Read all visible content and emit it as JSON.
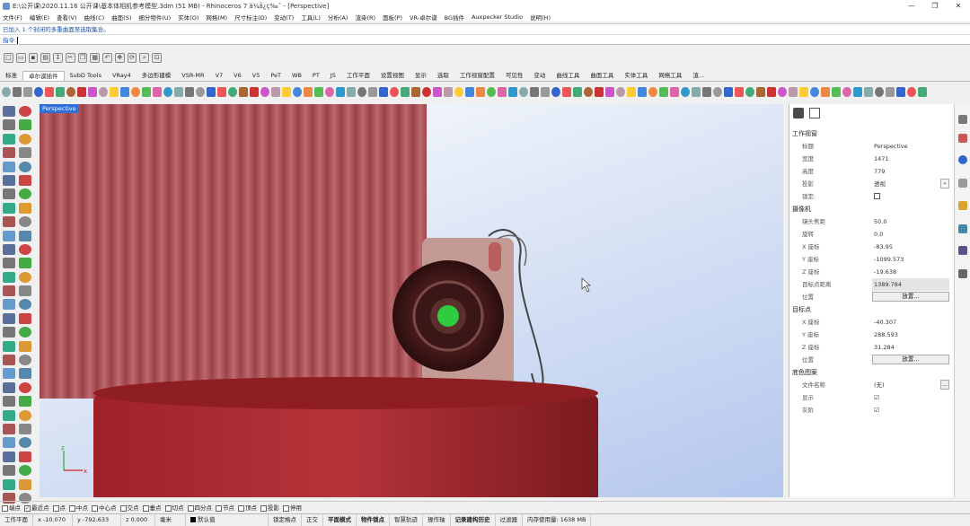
{
  "window": {
    "title": "E:\\公开课\\2020.11.16 公开课\\基本体相机参考模型.3dm (51 MB) - Rhinoceros 7 ä¼å¿ç‰ˆ - [Perspective]",
    "controls": [
      "—",
      "❐",
      "✕"
    ]
  },
  "menu": [
    "文件(F)",
    "编辑(E)",
    "查看(V)",
    "曲线(C)",
    "曲面(S)",
    "细分物件(U)",
    "实体(O)",
    "网格(M)",
    "尺寸标注(D)",
    "变动(T)",
    "工具(L)",
    "分析(A)",
    "渲染(R)",
    "面板(P)",
    "VR-卓尔谟",
    "BG插件",
    "Auxpecker Studio",
    "说明(H)"
  ],
  "command": {
    "history": "已加入 1 个封闭的多重曲面至选取集合。",
    "prompt": "指令:"
  },
  "tabs": [
    "标准",
    "卓尔谟插件",
    "SubD Tools",
    "VRay4",
    "多边形建模",
    "VSR-MR",
    "V7",
    "V6",
    "V5",
    "PeT",
    "WB",
    "PT",
    "JS",
    "工作平面",
    "设置视图",
    "显示",
    "选取",
    "工作视窗配置",
    "可见性",
    "变动",
    "曲线工具",
    "曲面工具",
    "实体工具",
    "网格工具",
    "渲..."
  ],
  "active_tab_index": 1,
  "viewport": {
    "label": "Perspective"
  },
  "properties": {
    "section_viewport": "工作视窗",
    "viewport_rows": [
      {
        "label": "标题",
        "value": "Perspective"
      },
      {
        "label": "宽度",
        "value": "1471"
      },
      {
        "label": "高度",
        "value": "779"
      },
      {
        "label": "投影",
        "value": "透视"
      },
      {
        "label": "锁定",
        "value": ""
      }
    ],
    "section_camera": "摄像机",
    "camera_rows": [
      {
        "label": "镜头焦距",
        "value": "50.0"
      },
      {
        "label": "旋转",
        "value": "0.0"
      },
      {
        "label": "X 座标",
        "value": "-83.95"
      },
      {
        "label": "Y 座标",
        "value": "-1099.573"
      },
      {
        "label": "Z 座标",
        "value": "-19.638"
      },
      {
        "label": "目标点距离",
        "value": "1389.784"
      },
      {
        "label": "位置",
        "value": "放置..."
      }
    ],
    "section_target": "目标点",
    "target_rows": [
      {
        "label": "X 座标",
        "value": "-40.307"
      },
      {
        "label": "Y 座标",
        "value": "288.593"
      },
      {
        "label": "Z 座标",
        "value": "31.284"
      },
      {
        "label": "位置",
        "value": "放置..."
      }
    ],
    "section_wallpaper": "底色图案",
    "wallpaper_rows": [
      {
        "label": "文件名称",
        "value": "(无)"
      },
      {
        "label": "显示",
        "value": "☑"
      },
      {
        "label": "灰阶",
        "value": "☑"
      }
    ]
  },
  "osnap": [
    {
      "label": "端点",
      "checked": false
    },
    {
      "label": "最近点",
      "checked": true
    },
    {
      "label": "点",
      "checked": false
    },
    {
      "label": "中点",
      "checked": false
    },
    {
      "label": "中心点",
      "checked": false
    },
    {
      "label": "交点",
      "checked": false
    },
    {
      "label": "垂点",
      "checked": false
    },
    {
      "label": "切点",
      "checked": false
    },
    {
      "label": "四分点",
      "checked": false
    },
    {
      "label": "节点",
      "checked": false
    },
    {
      "label": "顶点",
      "checked": false
    },
    {
      "label": "投影",
      "checked": false
    },
    {
      "label": "停用",
      "checked": false
    }
  ],
  "status": {
    "cplane": "工作平面",
    "x": "x -10.070",
    "y": "y -792.633",
    "z": "z 0.000",
    "unit": "毫米",
    "layer": "默认值",
    "items": [
      "锁定格点",
      "正交",
      "平面模式",
      "物件锁点",
      "智慧轨迹",
      "操作轴",
      "记录建构历史",
      "过滤器",
      "内存使用量: 1638 MB"
    ]
  },
  "colors": {
    "viewport_label_bg": "#2f6fd6",
    "cylinder": "#a52a2e",
    "corrugated": "#b2585d",
    "camera_body": "#c59c95",
    "lens_green": "#2ecc40"
  }
}
